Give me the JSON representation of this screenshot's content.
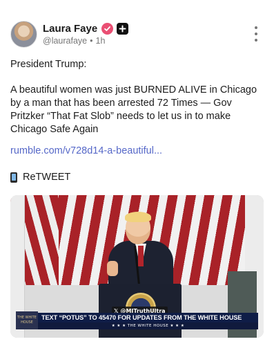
{
  "author": {
    "display_name": "Laura Faye",
    "handle": "@laurafaye",
    "separator": "•",
    "time": "1h"
  },
  "icons": {
    "verified": "verified-badge-icon",
    "follow": "plus-icon",
    "more": "more-vertical-icon",
    "retweet": "mobile-phone-icon"
  },
  "colors": {
    "badge": "#ea4f73",
    "link": "#5668c8",
    "ticker": "#0f1d47"
  },
  "post": {
    "greeting": "President Trump:",
    "body": "A beautiful women was just BURNED ALIVE in Chicago by a man that has been arrested 72 Times — Gov Pritzker “That Fat Slob” needs to let us in to make Chicago Safe Again",
    "link": "rumble.com/v728d14-a-beautiful...",
    "retweet_label": "ReTWEET"
  },
  "media": {
    "watermark": "@MJTruthUltra",
    "ticker": "TEXT “POTUS” TO 45470 FOR UPDATES FROM THE WHITE HOUSE",
    "subticker": "★ ★ ★  THE WHITE HOUSE  ★ ★ ★",
    "logo_text": "THE WHITE HOUSE"
  }
}
